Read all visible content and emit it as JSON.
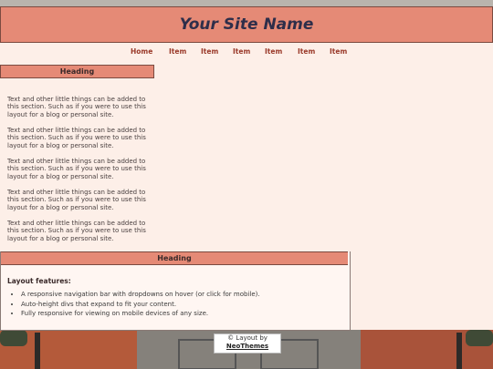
{
  "header": {
    "site_name": "Your Site Name"
  },
  "nav": {
    "items": [
      {
        "label": "Home"
      },
      {
        "label": "Item"
      },
      {
        "label": "Item"
      },
      {
        "label": "Item"
      },
      {
        "label": "Item"
      },
      {
        "label": "Item"
      },
      {
        "label": "Item"
      }
    ]
  },
  "sidebar": {
    "heading": "Heading",
    "paragraphs": [
      "Text and other little things can be added to this section. Such as if you were to use this layout for a blog or personal site.",
      "Text and other little things can be added to this section. Such as if you were to use this layout for a blog or personal site.",
      "Text and other little things can be added to this section. Such as if you were to use this layout for a blog or personal site.",
      "Text and other little things can be added to this section. Such as if you were to use this layout for a blog or personal site.",
      "Text and other little things can be added to this section. Such as if you were to use this layout for a blog or personal site."
    ]
  },
  "main": {
    "heading": "Heading",
    "features_title": "Layout features:",
    "features": [
      "A responsive navigation bar with dropdowns on hover (or click for mobile).",
      "Auto-height divs that expand to fit your content.",
      "Fully responsive for viewing on mobile devices of any size."
    ]
  },
  "footer": {
    "text": "© Layout by",
    "link": "NeoThemes"
  },
  "colors": {
    "accent": "#e58a76",
    "page_bg": "#fdefe8",
    "nav_text": "#9a3a2a",
    "title_text": "#2e2e4a"
  }
}
